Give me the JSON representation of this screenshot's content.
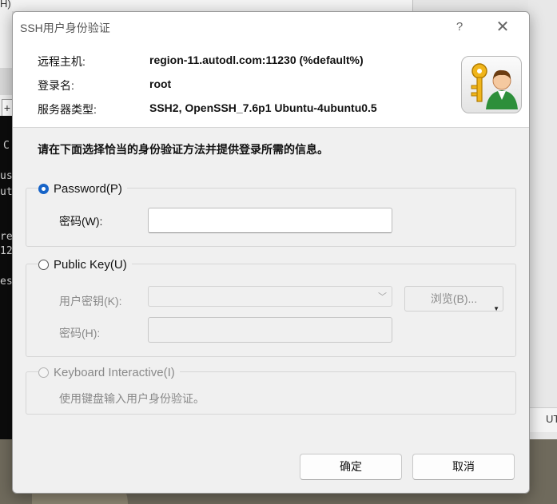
{
  "background": {
    "top_left_char": "H)",
    "terminal_lines": [
      "C",
      "us",
      "ut",
      "re",
      "12",
      "es"
    ],
    "right_bar_text": "UT"
  },
  "dialog": {
    "title": "SSH用户身份验证",
    "help_label": "?",
    "close_label": "✕",
    "info": {
      "remote_host_label": "远程主机:",
      "remote_host_value": "region-11.autodl.com:11230 (%default%)",
      "login_label": "登录名:",
      "login_value": "root",
      "server_type_label": "服务器类型:",
      "server_type_value": "SSH2, OpenSSH_7.6p1 Ubuntu-4ubuntu0.5"
    },
    "instruction": "请在下面选择恰当的身份验证方法并提供登录所需的信息。",
    "password_method": {
      "label": "Password(P)",
      "selected": true,
      "password_label": "密码(W):",
      "password_value": ""
    },
    "public_key_method": {
      "label": "Public Key(U)",
      "selected": false,
      "user_key_label": "用户密钥(K):",
      "user_key_value": "",
      "browse_label": "浏览(B)...",
      "passphrase_label": "密码(H):",
      "passphrase_value": ""
    },
    "keyboard_method": {
      "label": "Keyboard Interactive(I)",
      "selected": false,
      "hint": "使用键盘输入用户身份验证。"
    },
    "ok_label": "确定",
    "cancel_label": "取消"
  },
  "colors": {
    "accent": "#1764c8",
    "dialog_bg": "#f0f0f0",
    "disabled_text": "#8a8a8a"
  }
}
